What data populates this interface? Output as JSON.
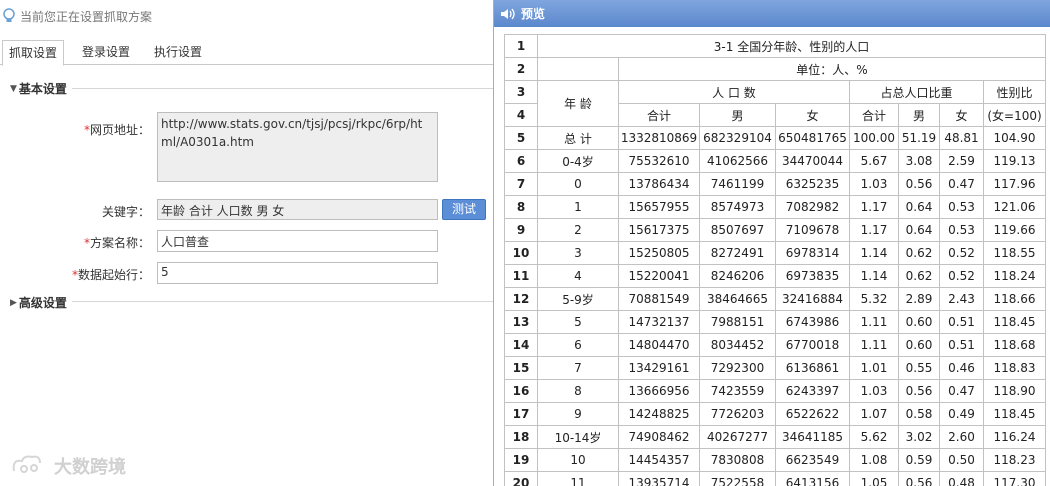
{
  "hint": "当前您正在设置抓取方案",
  "tabs": [
    "抓取设置",
    "登录设置",
    "执行设置"
  ],
  "basic_section": "基本设置",
  "advanced_section": "高级设置",
  "form": {
    "url_label": "网页地址：",
    "url_value": "http://www.stats.gov.cn/tjsj/pcsj/rkpc/6rp/html/A0301a.htm",
    "keyword_label": "关键字：",
    "keyword_value": "年龄 合计 人口数 男 女",
    "test_button": "测试",
    "name_label": "方案名称：",
    "name_value": "人口普查",
    "start_row_label": "数据起始行：",
    "start_row_value": "5"
  },
  "watermark": "大数跨境",
  "preview": {
    "title": "预览",
    "r1_title": "3-1 全国分年龄、性别的人口",
    "r2_unit": "单位：人、%",
    "r3_age": "年 龄",
    "r3_pop": "人 口 数",
    "r3_share": "占总人口比重",
    "r3_ratio": "性别比",
    "r4_total": "合计",
    "r4_male": "男",
    "r4_female": "女",
    "r4_share_total": "合计",
    "r4_share_male": "男",
    "r4_share_female": "女",
    "r4_ratio": "(女=100)",
    "header_row_numbers": [
      "1",
      "2",
      "3",
      "4"
    ],
    "rows": [
      [
        "5",
        "总 计",
        "1332810869",
        "682329104",
        "650481765",
        "100.00",
        "51.19",
        "48.81",
        "104.90"
      ],
      [
        "6",
        "0-4岁",
        "75532610",
        "41062566",
        "34470044",
        "5.67",
        "3.08",
        "2.59",
        "119.13"
      ],
      [
        "7",
        "0",
        "13786434",
        "7461199",
        "6325235",
        "1.03",
        "0.56",
        "0.47",
        "117.96"
      ],
      [
        "8",
        "1",
        "15657955",
        "8574973",
        "7082982",
        "1.17",
        "0.64",
        "0.53",
        "121.06"
      ],
      [
        "9",
        "2",
        "15617375",
        "8507697",
        "7109678",
        "1.17",
        "0.64",
        "0.53",
        "119.66"
      ],
      [
        "10",
        "3",
        "15250805",
        "8272491",
        "6978314",
        "1.14",
        "0.62",
        "0.52",
        "118.55"
      ],
      [
        "11",
        "4",
        "15220041",
        "8246206",
        "6973835",
        "1.14",
        "0.62",
        "0.52",
        "118.24"
      ],
      [
        "12",
        "5-9岁",
        "70881549",
        "38464665",
        "32416884",
        "5.32",
        "2.89",
        "2.43",
        "118.66"
      ],
      [
        "13",
        "5",
        "14732137",
        "7988151",
        "6743986",
        "1.11",
        "0.60",
        "0.51",
        "118.45"
      ],
      [
        "14",
        "6",
        "14804470",
        "8034452",
        "6770018",
        "1.11",
        "0.60",
        "0.51",
        "118.68"
      ],
      [
        "15",
        "7",
        "13429161",
        "7292300",
        "6136861",
        "1.01",
        "0.55",
        "0.46",
        "118.83"
      ],
      [
        "16",
        "8",
        "13666956",
        "7423559",
        "6243397",
        "1.03",
        "0.56",
        "0.47",
        "118.90"
      ],
      [
        "17",
        "9",
        "14248825",
        "7726203",
        "6522622",
        "1.07",
        "0.58",
        "0.49",
        "118.45"
      ],
      [
        "18",
        "10-14岁",
        "74908462",
        "40267277",
        "34641185",
        "5.62",
        "3.02",
        "2.60",
        "116.24"
      ],
      [
        "19",
        "10",
        "14454357",
        "7830808",
        "6623549",
        "1.08",
        "0.59",
        "0.50",
        "118.23"
      ],
      [
        "20",
        "11",
        "13935714",
        "7522558",
        "6413156",
        "1.05",
        "0.56",
        "0.48",
        "117.30"
      ]
    ]
  },
  "colors": {
    "titlebar": "#6b95d6",
    "button": "#5b8ed6",
    "required": "#dd3333"
  },
  "icons": [
    "lightbulb-icon",
    "speaker-icon",
    "triangle-down-icon",
    "triangle-right-icon"
  ]
}
